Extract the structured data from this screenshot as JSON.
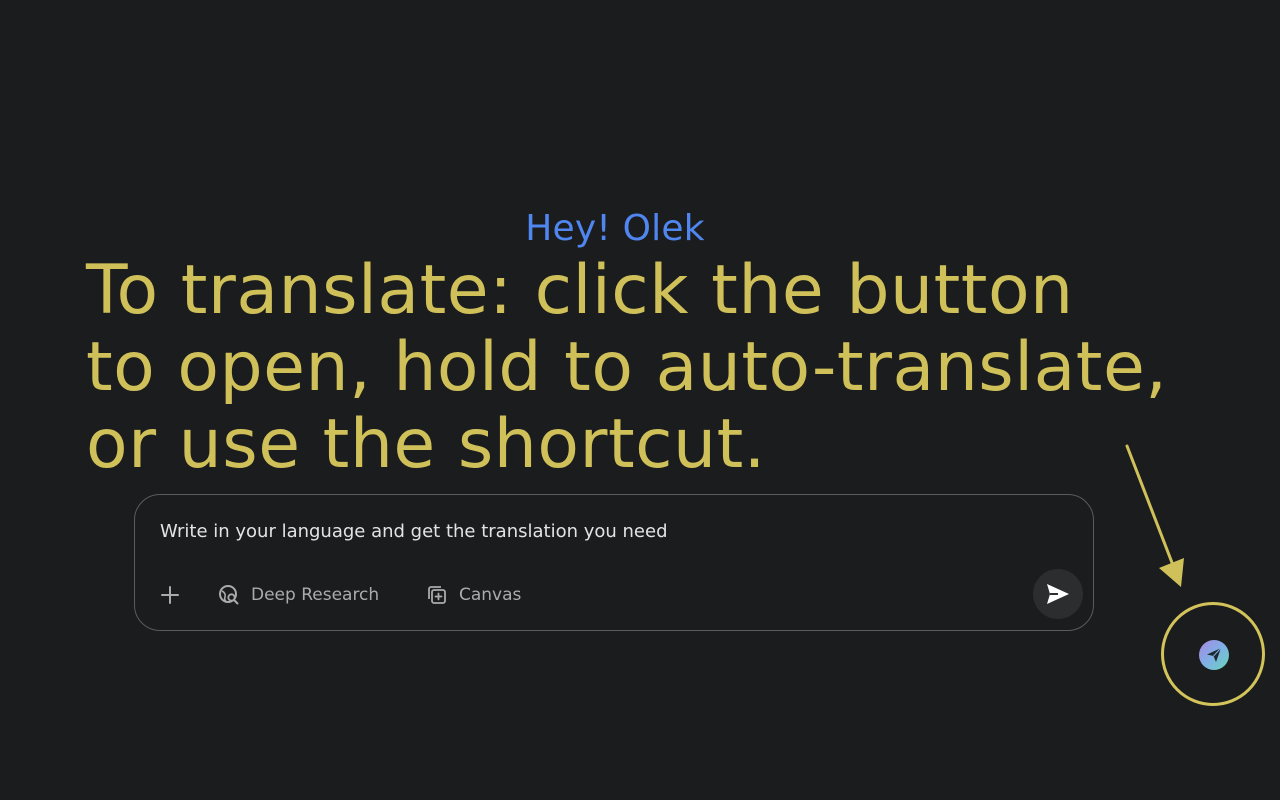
{
  "greeting": "Hey! Olek",
  "promo": {
    "lines": [
      "To translate: click the button",
      "to open, hold to auto-translate,",
      "or use the shortcut."
    ]
  },
  "composer": {
    "text": "Write in your language and get the translation you need",
    "tools": {
      "add_icon": "plus-icon",
      "deep_research_label": "Deep Research",
      "deep_research_icon": "globe-search-icon",
      "canvas_label": "Canvas",
      "canvas_icon": "canvas-add-icon"
    },
    "send_icon": "send-icon"
  },
  "extension": {
    "icon": "paper-plane-icon"
  },
  "colors": {
    "background": "#1b1c1d",
    "greeting": "#4f86f0",
    "promo": "#cfc05a",
    "highlight": "#d2c45a"
  }
}
